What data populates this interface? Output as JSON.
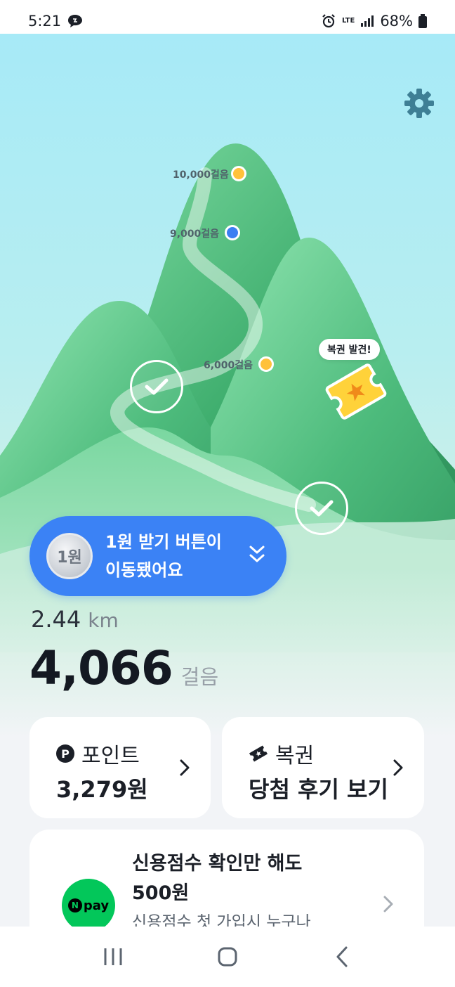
{
  "status_bar": {
    "time": "5:21",
    "network": "LTE",
    "battery": "68%"
  },
  "scene": {
    "milestones": [
      {
        "label": "10,000걸음",
        "dot": "yellow"
      },
      {
        "label": "9,000걸음",
        "dot": "blue"
      },
      {
        "label": "6,000걸음",
        "dot": "yellow"
      }
    ],
    "bubble_text": "복권 발견!"
  },
  "coin_button": {
    "coin_label": "1원",
    "line1": "1원 받기 버튼이",
    "line2": "이동됐어요"
  },
  "stats": {
    "distance": "2.44",
    "distance_unit": "km",
    "steps": "4,066",
    "steps_unit": "걸음"
  },
  "cards": {
    "points": {
      "icon_letter": "P",
      "title": "포인트",
      "value": "3,279원"
    },
    "lotto": {
      "title": "복권",
      "value": "당첨 후기 보기"
    }
  },
  "promo": {
    "title_line1": "신용점수 확인만 해도",
    "title_line2": "500원",
    "subtitle": "신용점수 첫 가입시 누구나",
    "logo_n": "N",
    "logo_pay": "pay"
  },
  "colors": {
    "accent_blue": "#3b82f5",
    "mountain_green": "#3fae6e",
    "npay_green": "#03c75a",
    "milestone_yellow": "#ffc13b"
  },
  "icons": [
    "settings-gear-icon",
    "check-icon",
    "ticket-icon",
    "chevron-right-icon",
    "double-chevron-down-icon",
    "recents-icon",
    "home-icon",
    "back-icon"
  ]
}
